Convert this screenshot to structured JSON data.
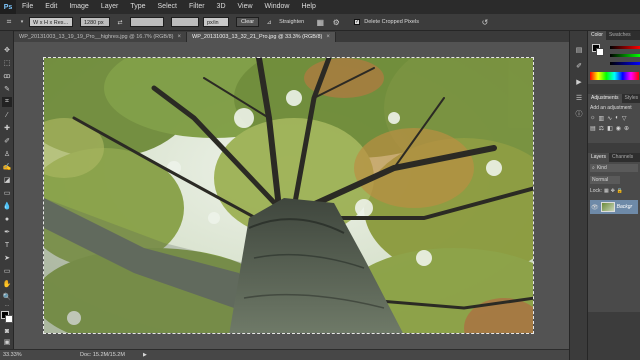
{
  "app": {
    "logo": "Ps"
  },
  "menu": [
    "File",
    "Edit",
    "Image",
    "Layer",
    "Type",
    "Select",
    "Filter",
    "3D",
    "View",
    "Window",
    "Help"
  ],
  "options": {
    "ratio_value": "W x H x Res...",
    "input_1": "1280 px",
    "input_2": "",
    "input_3": "",
    "unit": "px/in",
    "clear_label": "Clear",
    "straighten_label": "Straighten",
    "delete_cropped_label": "Delete Cropped Pixels"
  },
  "tabs": [
    {
      "label": "WP_20131003_13_19_19_Pro__highres.jpg @ 16.7% (RGB/8)",
      "active": false
    },
    {
      "label": "WP_20131003_13_32_21_Pro.jpg @ 33.3% (RGB/8)",
      "active": true
    }
  ],
  "status": {
    "zoom": "33.33%",
    "doc": "Doc: 15.2M/15.2M"
  },
  "panels": {
    "color_tabs": [
      "Color",
      "Swatches"
    ],
    "adjustments_tabs": [
      "Adjustments",
      "Styles"
    ],
    "adjustments_title": "Add an adjustment",
    "layers_tabs": [
      "Layers",
      "Channels"
    ],
    "kind_label": "Kind",
    "blend_mode": "Normal",
    "lock_label": "Lock:",
    "layer_name": "Backgr"
  },
  "colors": {
    "accent": "#7ec8ff",
    "ui_dark": "#2b2b2b",
    "ui_mid": "#3c3c3c",
    "ui_panel": "#535353"
  }
}
